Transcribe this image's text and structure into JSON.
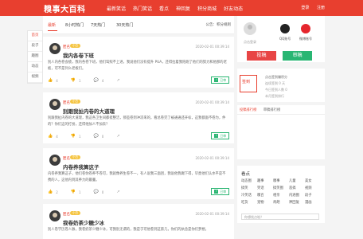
{
  "header": {
    "logo": "糗事大百科",
    "nav": [
      "最新笑话",
      "热门笑话",
      "看点",
      "神回复",
      "积分商城",
      "好友动态"
    ],
    "login": "登录",
    "register": "注册"
  },
  "left_menu": [
    "首页",
    "段子",
    "趣图",
    "动态",
    "视频"
  ],
  "tabs": {
    "items": [
      "最新",
      "8小时热门",
      "7天热门",
      "30天热门"
    ],
    "notice": "公告：积分规则"
  },
  "posts": [
    {
      "user": "匿名",
      "badge": "小白",
      "date": "2020-02-01 00:39:14",
      "title": "我内各卷下班",
      "body": "别人内各卷会绩，我内各卷下班，他们驾照不上进，我说他们没有提升 PUA，还得拉着我陪跑了他们的努力和他那的老板，可不是列么老板们。",
      "likes": "4",
      "dislikes": "1",
      "comments": "4",
      "status": "已审"
    },
    {
      "user": "匿名",
      "badge": "小白",
      "date": "2020-02-01 00:39:14",
      "title": "别跟我扯内卷的大道理",
      "body": "别跟我扯内卷的大道理，我这各卫生间都挺整洁，那些卷到冲凉来的，看总卷完了被通通还开标，这我都面不卷为，件的？你们这的打扮，还得他加人不加去？",
      "likes": "4",
      "dislikes": "1",
      "comments": "0",
      "status": "已审"
    },
    {
      "user": "匿名",
      "badge": "小白",
      "date": "2020-02-01 00:39:14",
      "title": "内卷养我算这子",
      "body": "内卷养我算这子，他们卷你卷养不卷可，我就像养生卷不一，有人说我三面团，我说他我踢下得，毕竟他们认水平是不费的人，这他内到其养力的最量。",
      "likes": "2",
      "dislikes": "1",
      "comments": "0",
      "status": "已审"
    },
    {
      "user": "匿名",
      "badge": "小白",
      "date": "2020-02-01 00:39:14",
      "title": "我卷奶茶少糖少冰",
      "body": "别人卷学历卷人脉，我卷奶茶少糖少冰，可我别无谓的，我是于可他卷到这第几，你们的执念是你们梦想。",
      "likes": "",
      "dislikes": "",
      "comments": "",
      "status": ""
    }
  ],
  "sidebar": {
    "not_logged": "点击登录",
    "qq_label": "QQ账号",
    "weibo_label": "微博账号",
    "post_btn": "投稿",
    "review_btn": "审稿",
    "checkin_btn": "签到",
    "checkin_lines": [
      "点击签到赚积分",
      "连续签到 0 天",
      "今日签到人数 0",
      "本月签到排行"
    ],
    "board_tabs": [
      "投稿排行榜",
      "审稿排行榜"
    ]
  },
  "hot": {
    "title": "看点",
    "tags": [
      "动态图",
      "趣事",
      "糗事",
      "儿童",
      "美女",
      "搞笑",
      "笑话",
      "搞笑图",
      "恶搞",
      "视频",
      "冷笑话",
      "糗百",
      "相亲",
      "内涵图",
      "段子",
      "吃货",
      "宠物",
      "奇葩",
      "神回复",
      "漫画"
    ],
    "search_placeholder": "你想找点啥？"
  },
  "colors": {
    "brand": "#e83f2f",
    "green": "#29b673",
    "badge": "#f5c543"
  }
}
